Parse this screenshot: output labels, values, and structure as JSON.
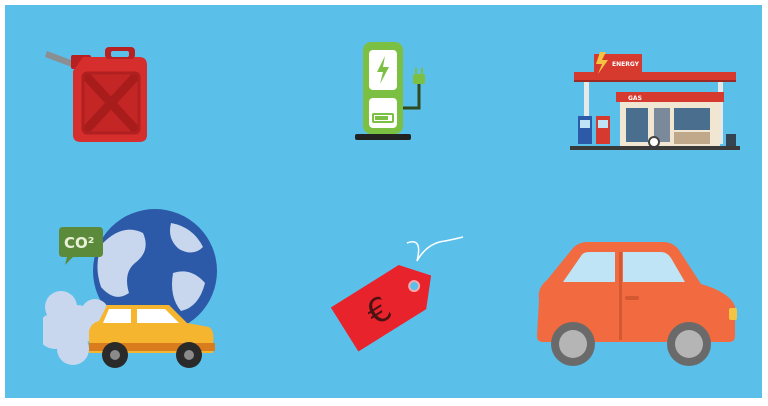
{
  "icons": {
    "fuel_can": {
      "name": "fuel-can-icon",
      "color": "#d62d2d"
    },
    "ev_charger": {
      "name": "ev-charger-icon",
      "color": "#7cc043"
    },
    "gas_station": {
      "name": "gas-station-icon",
      "sign_text": "ENERGY",
      "canopy_text": "GAS",
      "color": "#d63a2f"
    },
    "pollution": {
      "name": "co2-pollution-icon",
      "bubble_text": "CO²",
      "color": "#2d5aa8"
    },
    "price_tag": {
      "name": "euro-price-tag-icon",
      "symbol": "€",
      "color": "#e8232b"
    },
    "car": {
      "name": "car-icon",
      "color": "#f26a3f"
    }
  },
  "colors": {
    "background": "#5ac0ea"
  }
}
